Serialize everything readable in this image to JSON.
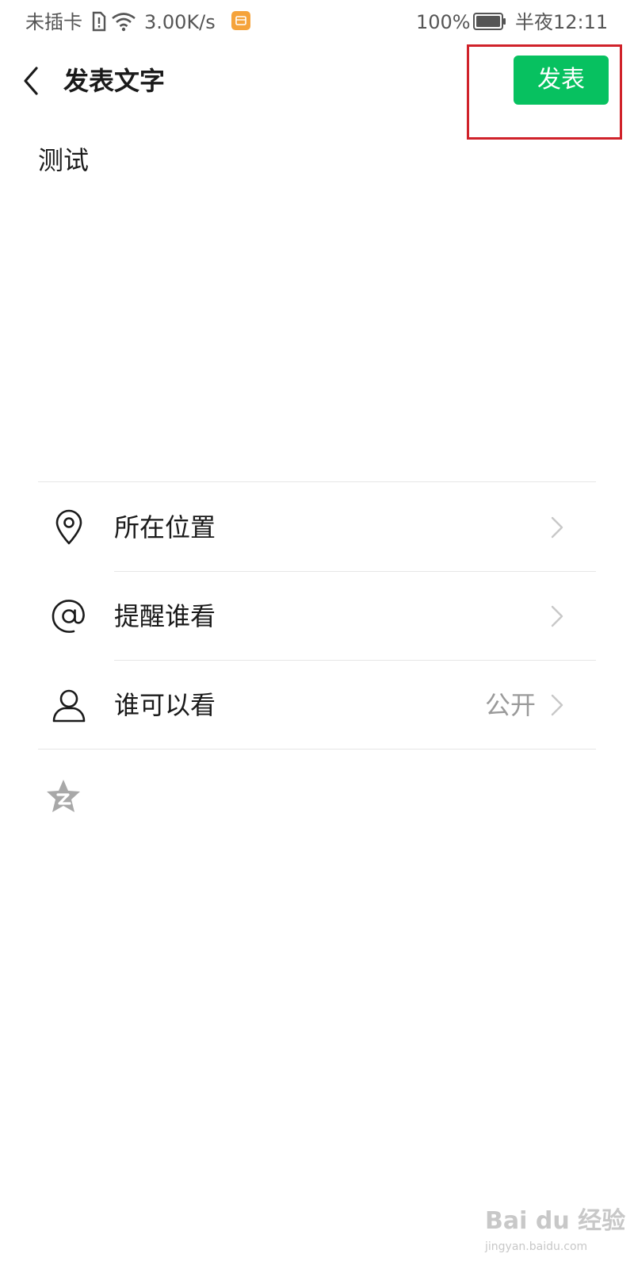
{
  "status_bar": {
    "carrier": "未插卡",
    "network_speed": "3.00K/s",
    "battery_percent": "100%",
    "time": "半夜12:11",
    "icons": [
      "sim-alert-icon",
      "wifi-icon",
      "app-notification-icon",
      "battery-icon"
    ]
  },
  "header": {
    "back_icon": "chevron-left-icon",
    "title": "发表文字",
    "publish_label": "发表",
    "publish_color": "#07c160",
    "highlight_color": "#d0222a"
  },
  "compose": {
    "text": "测试"
  },
  "options": [
    {
      "icon": "location-pin-icon",
      "label": "所在位置",
      "value": ""
    },
    {
      "icon": "at-sign-icon",
      "label": "提醒谁看",
      "value": ""
    },
    {
      "icon": "person-icon",
      "label": "谁可以看",
      "value": "公开"
    }
  ],
  "share": {
    "icon": "qzone-star-icon"
  },
  "watermark": {
    "brand": "Bai du 经验",
    "url": "jingyan.baidu.com"
  }
}
